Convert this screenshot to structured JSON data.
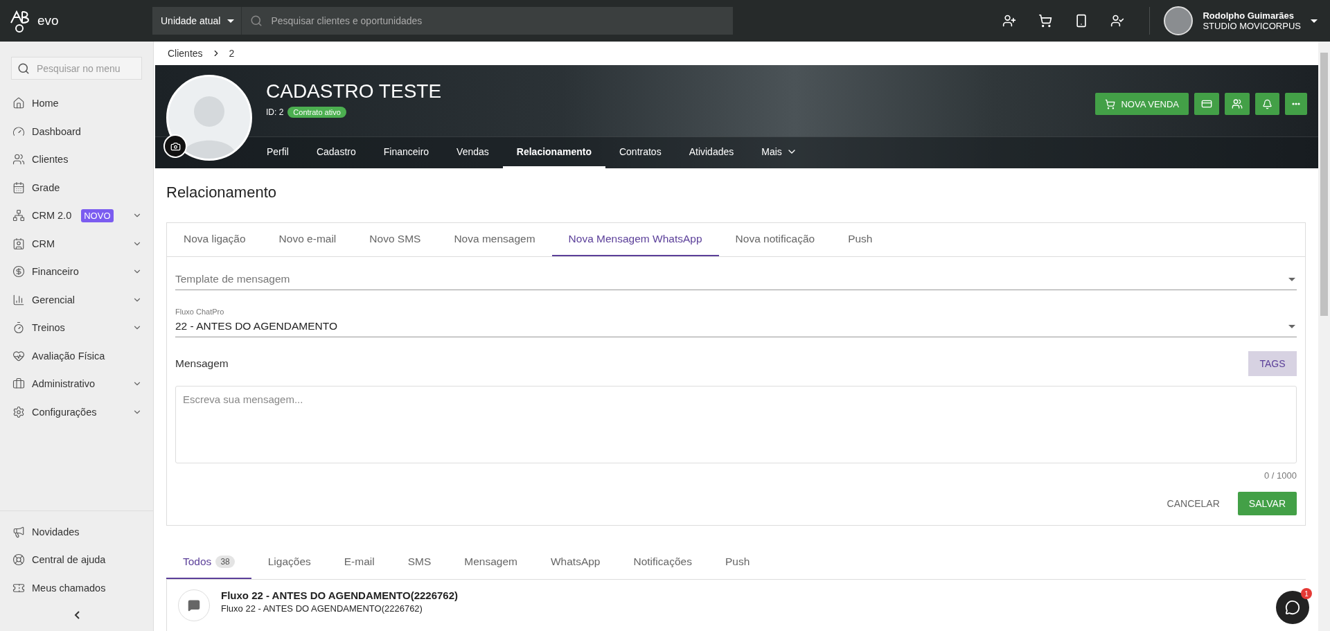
{
  "topbar": {
    "logo": "evo",
    "unit_select": "Unidade atual",
    "search_placeholder": "Pesquisar clientes e oportunidades",
    "user": {
      "name": "Rodolpho Guimarães",
      "company": "STUDIO MOVICORPUS"
    }
  },
  "sidebar": {
    "search_placeholder": "Pesquisar no menu",
    "items": [
      {
        "label": "Home",
        "expandable": false
      },
      {
        "label": "Dashboard",
        "expandable": false
      },
      {
        "label": "Clientes",
        "expandable": false
      },
      {
        "label": "Grade",
        "expandable": false
      },
      {
        "label": "CRM 2.0",
        "badge": "NOVO",
        "expandable": true
      },
      {
        "label": "CRM",
        "expandable": true
      },
      {
        "label": "Financeiro",
        "expandable": true
      },
      {
        "label": "Gerencial",
        "expandable": true
      },
      {
        "label": "Treinos",
        "expandable": true
      },
      {
        "label": "Avaliação Física",
        "expandable": false
      },
      {
        "label": "Administrativo",
        "expandable": true
      },
      {
        "label": "Configurações",
        "expandable": true
      }
    ],
    "footer_items": [
      {
        "label": "Novidades"
      },
      {
        "label": "Central de ajuda"
      },
      {
        "label": "Meus chamados"
      }
    ]
  },
  "breadcrumb": [
    "Clientes",
    "2"
  ],
  "profile": {
    "name": "CADASTRO TESTE",
    "id": "ID: 2",
    "status": "Contrato ativo",
    "primary_button": "NOVA VENDA",
    "tabs": [
      {
        "label": "Perfil",
        "selected": false
      },
      {
        "label": "Cadastro",
        "selected": false
      },
      {
        "label": "Financeiro",
        "selected": false
      },
      {
        "label": "Vendas",
        "selected": false
      },
      {
        "label": "Relacionamento",
        "selected": true
      },
      {
        "label": "Contratos",
        "selected": false
      },
      {
        "label": "Atividades",
        "selected": false
      },
      {
        "label": "Mais",
        "selected": false
      }
    ]
  },
  "section_title": "Relacionamento",
  "composer": {
    "tabs": [
      {
        "label": "Nova ligação",
        "selected": false
      },
      {
        "label": "Novo e-mail",
        "selected": false
      },
      {
        "label": "Novo SMS",
        "selected": false
      },
      {
        "label": "Nova mensagem",
        "selected": false
      },
      {
        "label": "Nova Mensagem WhatsApp",
        "selected": true
      },
      {
        "label": "Nova notificação",
        "selected": false
      },
      {
        "label": "Push",
        "selected": false
      }
    ],
    "template_placeholder": "Template de mensagem",
    "flow_label": "Fluxo ChatPro",
    "flow_value": "22 - ANTES DO AGENDAMENTO",
    "message_label": "Mensagem",
    "tags_button": "TAGS",
    "message_placeholder": "Escreva sua mensagem...",
    "counter": "0 / 1000",
    "cancel_button": "CANCELAR",
    "save_button": "SALVAR"
  },
  "history": {
    "tabs": [
      {
        "label": "Todos",
        "count": "38",
        "selected": true
      },
      {
        "label": "Ligações",
        "selected": false
      },
      {
        "label": "E-mail",
        "selected": false
      },
      {
        "label": "SMS",
        "selected": false
      },
      {
        "label": "Mensagem",
        "selected": false
      },
      {
        "label": "WhatsApp",
        "selected": false
      },
      {
        "label": "Notificações",
        "selected": false
      },
      {
        "label": "Push",
        "selected": false
      }
    ],
    "entries": [
      {
        "title": "Fluxo 22 - ANTES DO AGENDAMENTO(2226762)",
        "subtitle": "Fluxo 22 - ANTES DO AGENDAMENTO(2226762)"
      }
    ]
  },
  "chat_widget": {
    "unread": "1"
  }
}
